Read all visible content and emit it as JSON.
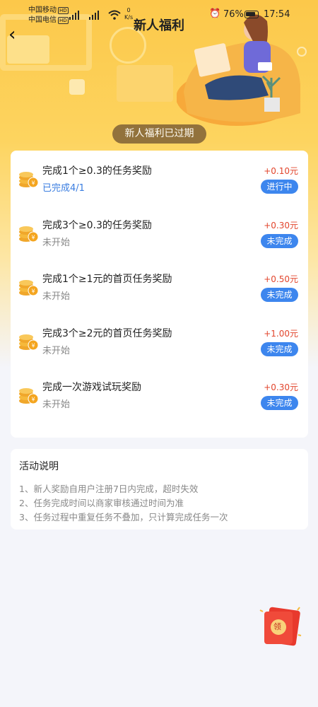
{
  "status_bar": {
    "carrier1": "中国移动",
    "carrier2": "中国电信",
    "hd": "HD",
    "net_type": "4G",
    "net_speed_value": "0",
    "net_speed_unit": "K/s",
    "battery": "76%",
    "time": "17:54"
  },
  "header": {
    "title": "新人福利",
    "expired_label": "新人福利已过期"
  },
  "tasks": [
    {
      "name": "完成1个≥0.3的任务奖励",
      "status": "已完成4/1",
      "amount": "+0.10元",
      "badge": "进行中"
    },
    {
      "name": "完成3个≥0.3的任务奖励",
      "status": "未开始",
      "amount": "+0.30元",
      "badge": "未完成"
    },
    {
      "name": "完成1个≥1元的首页任务奖励",
      "status": "未开始",
      "amount": "+0.50元",
      "badge": "未完成"
    },
    {
      "name": "完成3个≥2元的首页任务奖励",
      "status": "未开始",
      "amount": "+1.00元",
      "badge": "未完成"
    },
    {
      "name": "完成一次游戏试玩奖励",
      "status": "未开始",
      "amount": "+0.30元",
      "badge": "未完成"
    }
  ],
  "activity": {
    "title": "活动说明",
    "lines": [
      "1、新人奖励自用户注册7日内完成，超时失效",
      "2、任务完成时间以商家审核通过时间为准",
      "3、任务过程中重复任务不叠加，只计算完成任务一次"
    ]
  },
  "floating": {
    "red_packet_label": "领"
  },
  "colors": {
    "hero_yellow": "#fcc84a",
    "amount_red": "#e2452c",
    "badge_blue": "#3d86ee",
    "done_blue": "#3a7de0"
  }
}
